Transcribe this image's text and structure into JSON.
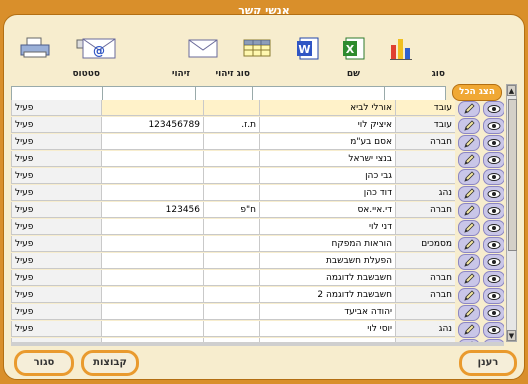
{
  "window": {
    "title": "אנשי קשר"
  },
  "toolbar": {
    "icons": [
      "chart-icon",
      "excel-icon",
      "word-icon",
      "grid-icon",
      "mail-icon",
      "email-address-icon",
      "printer-icon"
    ],
    "word_letter": "W",
    "excel_letter": "X"
  },
  "columns": {
    "type": "סוג",
    "name": "שם",
    "id_type": "סוג זיהוי",
    "id_number": "זיהוי",
    "status": "סטטוס"
  },
  "show_all_label": "הצג הכל",
  "rows": [
    {
      "type": "עובד",
      "name": "אורלי לביא",
      "id_type": "",
      "id_number": "",
      "status": "פעיל"
    },
    {
      "type": "עובד",
      "name": "איציק לוי",
      "id_type": "ת.ז.",
      "id_number": "123456789",
      "status": "פעיל"
    },
    {
      "type": "חברה",
      "name": "אסם בע\"מ",
      "id_type": "",
      "id_number": "",
      "status": "פעיל"
    },
    {
      "type": "",
      "name": "בנצי ישראל",
      "id_type": "",
      "id_number": "",
      "status": "פעיל"
    },
    {
      "type": "",
      "name": "גבי כהן",
      "id_type": "",
      "id_number": "",
      "status": "פעיל"
    },
    {
      "type": "נהג",
      "name": "דוד כהן",
      "id_type": "",
      "id_number": "",
      "status": "פעיל"
    },
    {
      "type": "חברה",
      "name": "די.איי.אס",
      "id_type": "ח\"פ",
      "id_number": "123456",
      "status": "פעיל"
    },
    {
      "type": "",
      "name": "דני לוי",
      "id_type": "",
      "id_number": "",
      "status": "פעיל"
    },
    {
      "type": "מסמכים",
      "name": "הוראות המפקח",
      "id_type": "",
      "id_number": "",
      "status": "פעיל"
    },
    {
      "type": "",
      "name": "הפעלת חשבשבת",
      "id_type": "",
      "id_number": "",
      "status": "פעיל"
    },
    {
      "type": "חברה",
      "name": "חשבשבת לדוגמה",
      "id_type": "",
      "id_number": "",
      "status": "פעיל"
    },
    {
      "type": "חברה",
      "name": "חשבשבת לדוגמה 2",
      "id_type": "",
      "id_number": "",
      "status": "פעיל"
    },
    {
      "type": "",
      "name": "יהודה אביעד",
      "id_type": "",
      "id_number": "",
      "status": "פעיל"
    },
    {
      "type": "נהג",
      "name": "יוסי לוי",
      "id_type": "",
      "id_number": "",
      "status": "פעיל"
    },
    {
      "type": "",
      "name": "",
      "id_type": "",
      "id_number": "",
      "status": ""
    }
  ],
  "buttons": {
    "refresh": "רענן",
    "groups": "קבוצות",
    "close": "סגור"
  },
  "scrollbar": {
    "up": "▲",
    "down": "▼"
  },
  "colors": {
    "frame": "#d98f2b",
    "panel": "#f7edce",
    "pill_border": "#e99a2e"
  }
}
